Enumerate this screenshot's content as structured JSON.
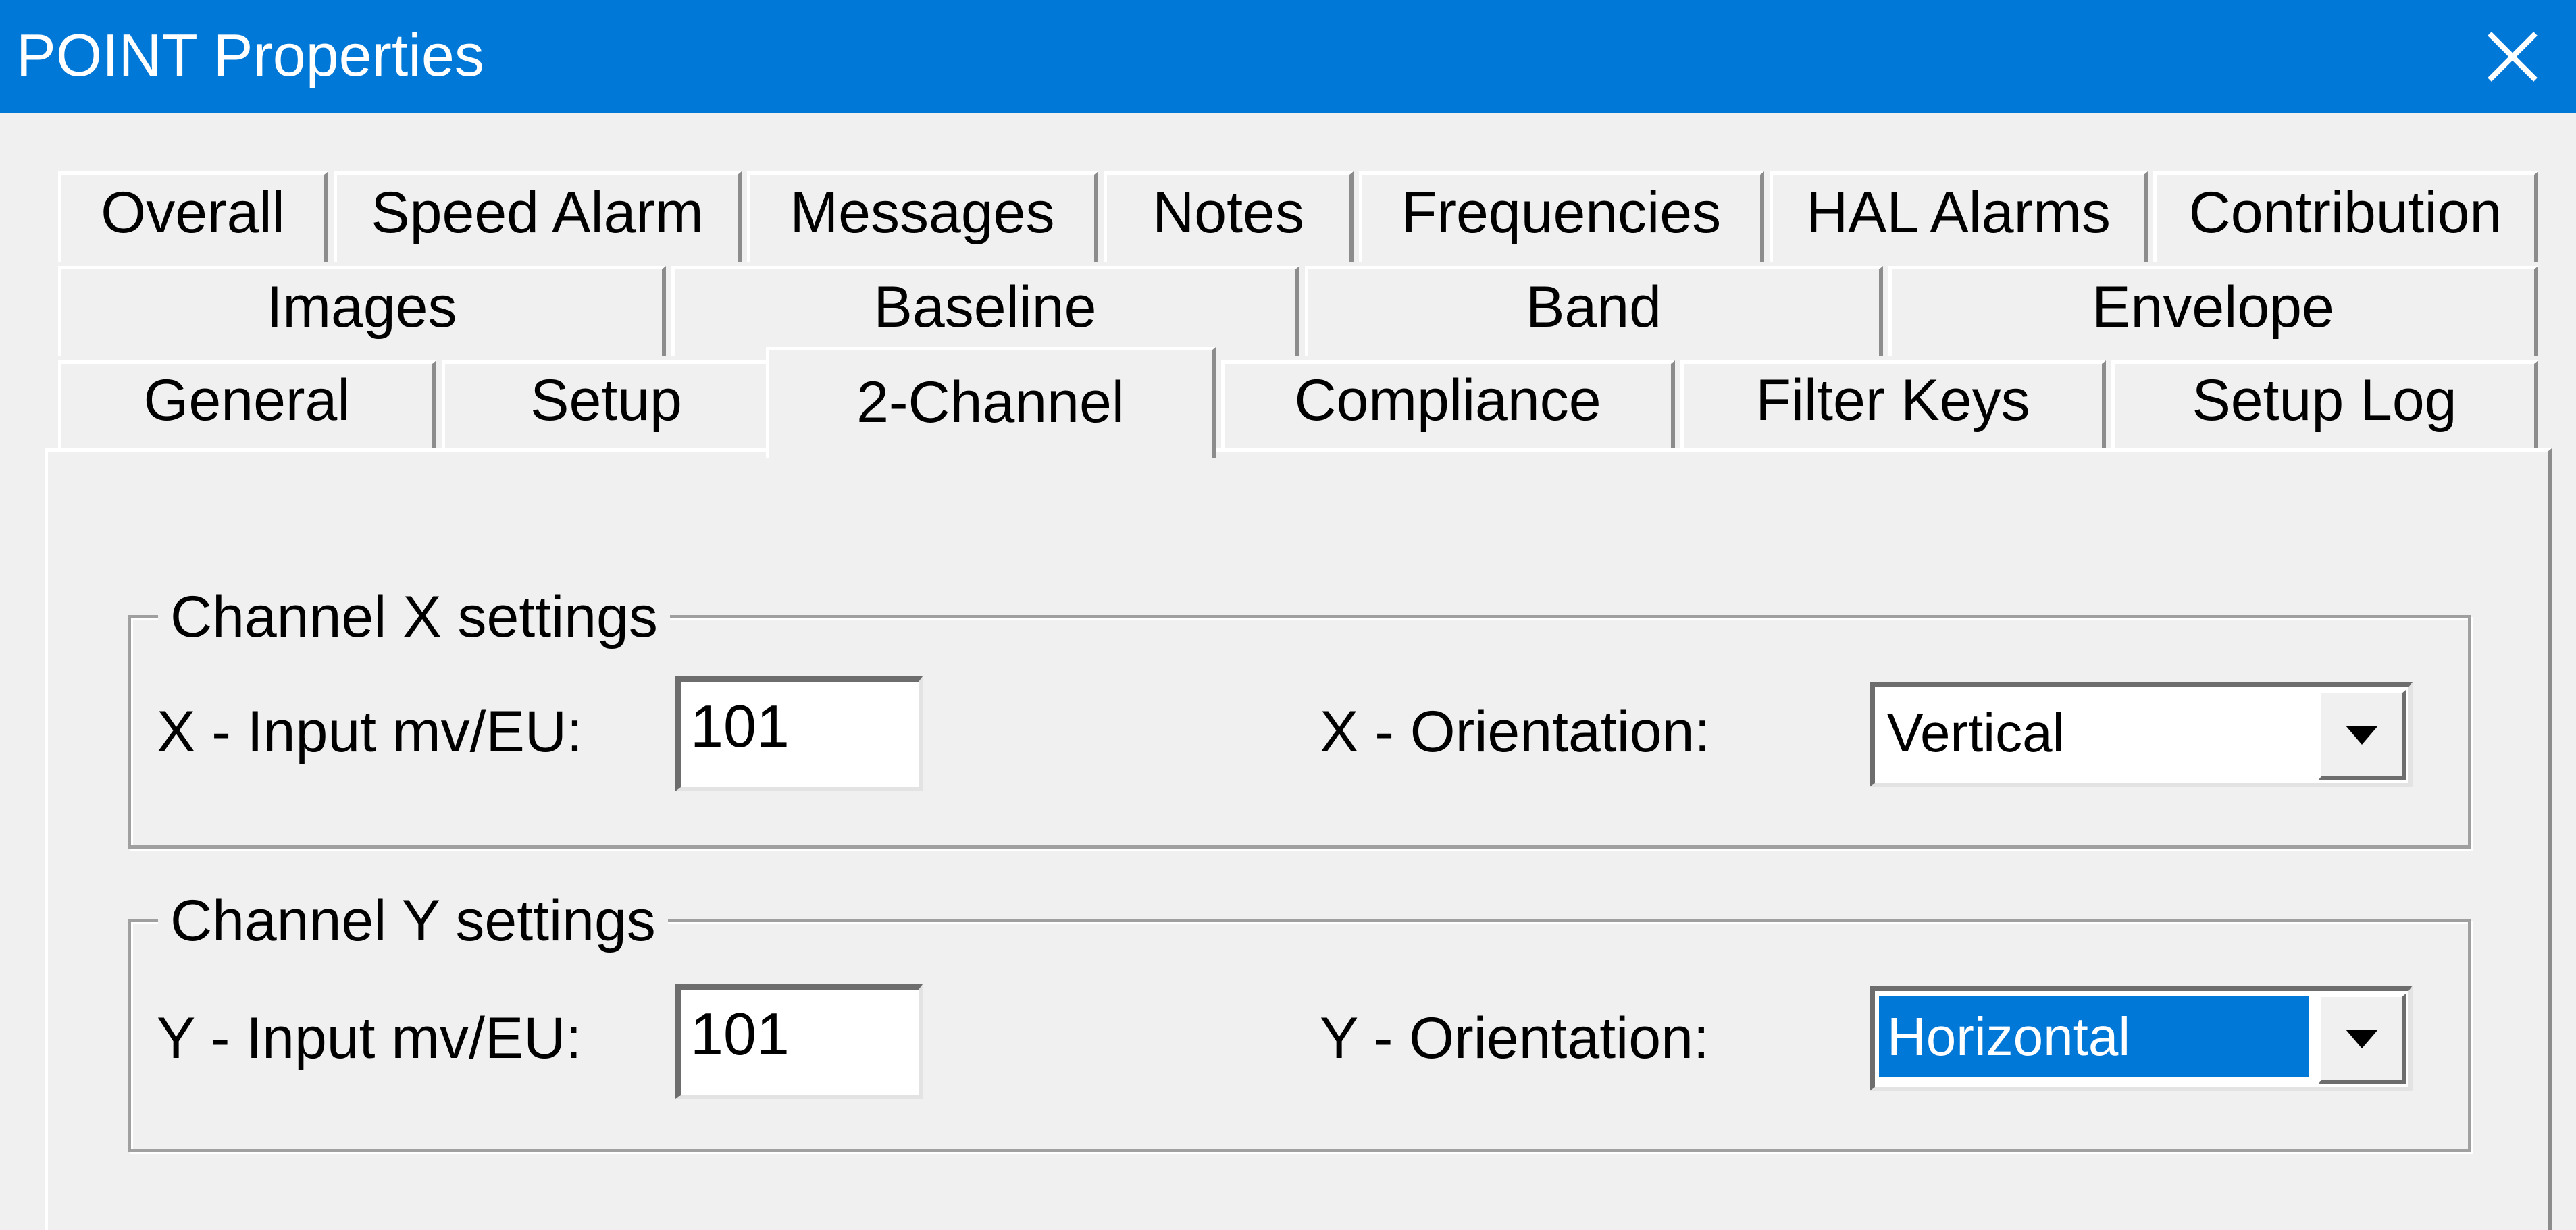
{
  "window": {
    "title": "POINT Properties"
  },
  "tabs": {
    "row1": [
      "Overall",
      "Speed Alarm",
      "Messages",
      "Notes",
      "Frequencies",
      "HAL Alarms",
      "Contribution"
    ],
    "row2": [
      "Images",
      "Baseline",
      "Band",
      "Envelope"
    ],
    "row3": [
      "General",
      "Setup",
      "2-Channel",
      "Compliance",
      "Filter Keys",
      "Setup Log"
    ],
    "active": "2-Channel"
  },
  "channel_x": {
    "legend": "Channel X settings",
    "input_label": "X - Input mv/EU:",
    "input_value": "101",
    "orientation_label": "X - Orientation:",
    "orientation_value": "Vertical"
  },
  "channel_y": {
    "legend": "Channel Y settings",
    "input_label": "Y - Input mv/EU:",
    "input_value": "101",
    "orientation_label": "Y - Orientation:",
    "orientation_value": "Horizontal"
  },
  "icons": {
    "close": "close-icon",
    "dropdown": "chevron-down-icon"
  },
  "colors": {
    "titlebar": "#0078d7",
    "selection": "#0078d7",
    "dialog": "#f0f0f0"
  }
}
